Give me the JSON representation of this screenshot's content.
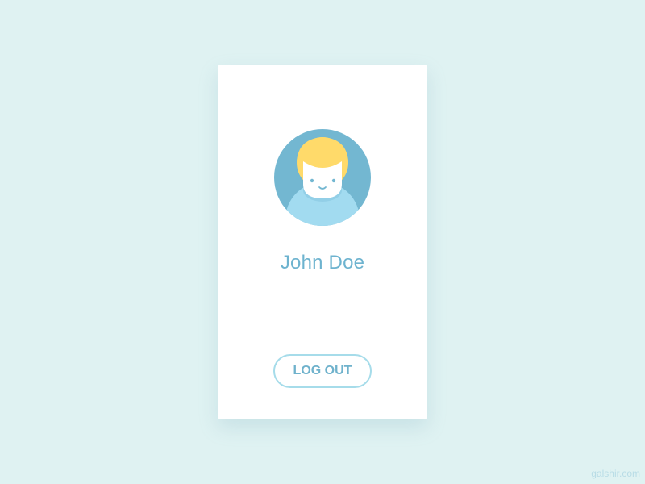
{
  "profile": {
    "name": "John Doe",
    "avatar_icon": "user-avatar-icon"
  },
  "actions": {
    "logout_label": "LOG OUT"
  },
  "footer": {
    "credit": "galshir.com"
  },
  "colors": {
    "background": "#dff2f2",
    "card": "#ffffff",
    "accent": "#6db3cf",
    "button_border": "#a6dcea",
    "avatar_bg": "#73b7d1",
    "hair": "#ffda6a",
    "shirt": "#a2dbf0"
  }
}
